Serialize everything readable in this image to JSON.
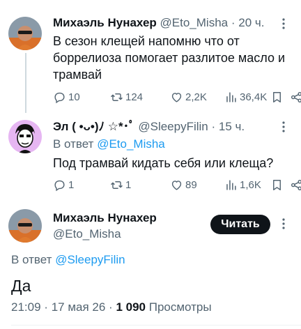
{
  "thread": [
    {
      "display_name": "Михаэль Нунахер",
      "handle": "@Eto_Misha",
      "separator": "·",
      "time": "20 ч.",
      "text": "В сезон клещей напомню что от боррелиоза помогает разлитое масло и трамвай",
      "stats": {
        "replies": "10",
        "retweets": "124",
        "likes": "2,2K",
        "views": "36,4K"
      }
    },
    {
      "display_name": "Эл ( •ᴗ•)ﾉ ☆*･ﾟ",
      "handle": "@SleepyFilin",
      "separator": "·",
      "time": "15 ч.",
      "reply_prefix": "В ответ",
      "reply_to": "@Eto_Misha",
      "text": "Под трамвай кидать себя или клеща?",
      "stats": {
        "replies": "1",
        "retweets": "1",
        "likes": "89",
        "views": "1,6K"
      }
    }
  ],
  "main_tweet": {
    "display_name": "Михаэль Нунахер",
    "handle": "@Eto_Misha",
    "follow_label": "Читать",
    "reply_prefix": "В ответ",
    "reply_to": "@SleepyFilin",
    "text": "Да",
    "time": "21:09",
    "separator": "·",
    "date": "17 мая 26",
    "views_count": "1 090",
    "views_label": "Просмотры"
  },
  "colors": {
    "accent": "#1d9bf0",
    "text": "#0f1419",
    "secondary": "#536471",
    "button": "#0f1419"
  },
  "icons": [
    "reply-icon",
    "retweet-icon",
    "like-icon",
    "views-icon",
    "bookmark-icon",
    "share-icon",
    "more-icon"
  ]
}
